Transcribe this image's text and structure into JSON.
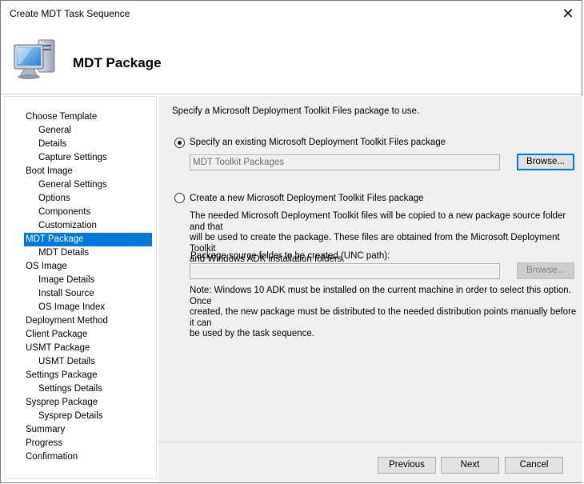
{
  "window": {
    "title": "Create MDT Task Sequence",
    "close_glyph": "✕"
  },
  "header": {
    "heading": "MDT Package",
    "icon": "computer-icon"
  },
  "sidebar": {
    "items": [
      {
        "label": "Choose Template",
        "level": 0
      },
      {
        "label": "General",
        "level": 1
      },
      {
        "label": "Details",
        "level": 1
      },
      {
        "label": "Capture Settings",
        "level": 1
      },
      {
        "label": "Boot Image",
        "level": 0
      },
      {
        "label": "General Settings",
        "level": 1
      },
      {
        "label": "Options",
        "level": 1
      },
      {
        "label": "Components",
        "level": 1
      },
      {
        "label": "Customization",
        "level": 1
      },
      {
        "label": "MDT Package",
        "level": 0,
        "active": true
      },
      {
        "label": "MDT Details",
        "level": 1
      },
      {
        "label": "OS Image",
        "level": 0
      },
      {
        "label": "Image Details",
        "level": 1
      },
      {
        "label": "Install Source",
        "level": 1
      },
      {
        "label": "OS Image Index",
        "level": 1
      },
      {
        "label": "Deployment Method",
        "level": 0
      },
      {
        "label": "Client Package",
        "level": 0
      },
      {
        "label": "USMT Package",
        "level": 0
      },
      {
        "label": "USMT Details",
        "level": 1
      },
      {
        "label": "Settings Package",
        "level": 0
      },
      {
        "label": "Settings Details",
        "level": 1
      },
      {
        "label": "Sysprep Package",
        "level": 0
      },
      {
        "label": "Sysprep Details",
        "level": 1
      },
      {
        "label": "Summary",
        "level": 0
      },
      {
        "label": "Progress",
        "level": 0
      },
      {
        "label": "Confirmation",
        "level": 0
      }
    ]
  },
  "main": {
    "instruction": "Specify a Microsoft Deployment Toolkit Files package to use.",
    "option_existing": {
      "label": "Specify an existing Microsoft Deployment Toolkit Files package",
      "checked": true,
      "field_value": "MDT Toolkit Packages",
      "browse_label": "Browse..."
    },
    "option_new": {
      "label": "Create a new Microsoft Deployment Toolkit Files package",
      "checked": false,
      "description_lines": [
        "The needed Microsoft Deployment Toolkit files will be copied to a new package source folder and that",
        "will be used to create the package.  These files are obtained from the Microsoft Deployment Toolkit",
        "and Windows ADK installation folders."
      ],
      "folder_label": "Package source folder to be created (UNC path):",
      "folder_value": "",
      "browse_label": "Browse...",
      "note_lines": [
        "Note: Windows 10 ADK must be installed on the current machine in order to select this option.  Once",
        "created, the new package must be distributed to the needed distribution points manually before it can",
        "be used by the task sequence."
      ]
    }
  },
  "footer": {
    "previous_label": "Previous",
    "next_label": "Next",
    "cancel_label": "Cancel"
  }
}
